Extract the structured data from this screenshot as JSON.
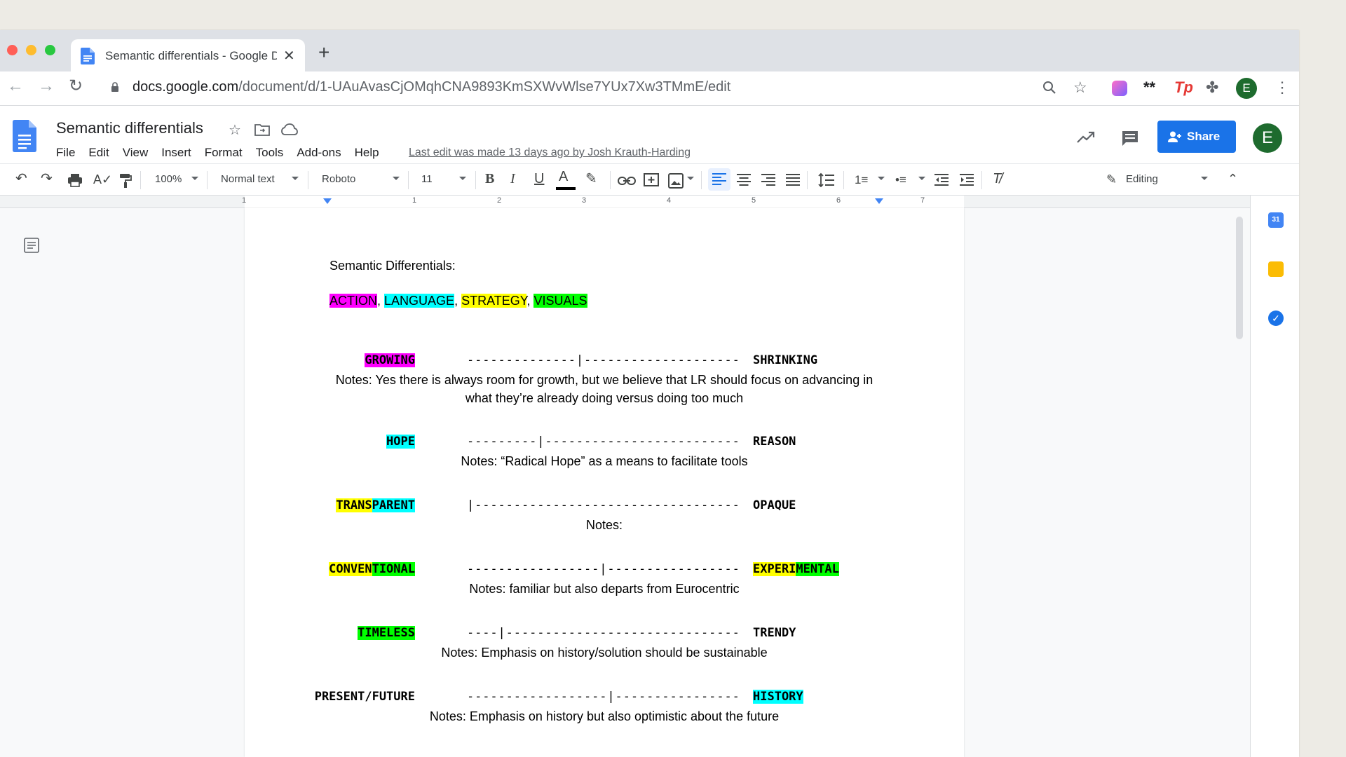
{
  "browser": {
    "tab_title": "Semantic differentials - Google Docs",
    "tab_close": "✕",
    "new_tab": "+",
    "url_host": "docs.google.com",
    "url_path": "/document/d/1-UAuAvasCjOMqhCNA9893KmSXWvWlse7YUx7Xw3TMmE/edit",
    "profile_initial": "E"
  },
  "docs": {
    "title": "Semantic differentials",
    "menu": [
      "File",
      "Edit",
      "View",
      "Insert",
      "Format",
      "Tools",
      "Add-ons",
      "Help"
    ],
    "last_edit": "Last edit was made 13 days ago by Josh Krauth-Harding",
    "share_label": "Share",
    "avatar_initial": "E"
  },
  "toolbar": {
    "zoom": "100%",
    "style": "Normal text",
    "font": "Roboto",
    "font_size": "11",
    "mode": "Editing"
  },
  "ruler": {
    "marks": [
      "1",
      "1",
      "2",
      "3",
      "4",
      "5",
      "6",
      "7"
    ]
  },
  "colors": {
    "accent": "#1a73e8",
    "magenta": "#ff00ff",
    "cyan": "#00ffff",
    "yellow": "#ffff00",
    "green": "#00ff00"
  },
  "document": {
    "heading": "Semantic Differentials:",
    "legend": {
      "action": "ACTION",
      "language": "LANGUAGE",
      "strategy": "STRATEGY",
      "visuals": "VISUALS",
      "sep": ", "
    },
    "rows": [
      {
        "left_parts": [
          "GROWING"
        ],
        "scale": "--------------|--------------------",
        "right_parts": [
          "SHRINKING"
        ],
        "note": "Notes: Yes there is always room for growth, but we believe that LR should focus on advancing in what they’re already doing versus doing too much"
      },
      {
        "left_parts": [
          "HOPE"
        ],
        "scale": "---------|-------------------------",
        "right_parts": [
          "REASON"
        ],
        "note": "Notes: “Radical Hope” as a means to facilitate tools"
      },
      {
        "left_parts": [
          "TRANS",
          "PARENT"
        ],
        "scale": "|----------------------------------",
        "right_parts": [
          "OPAQUE"
        ],
        "note": "Notes:"
      },
      {
        "left_parts": [
          "CONVEN",
          "TIONAL"
        ],
        "scale": "-----------------|-----------------",
        "right_parts": [
          "EXPERI",
          "MENTAL"
        ],
        "note": "Notes: familiar but also departs from Eurocentric"
      },
      {
        "left_parts": [
          "TIMELESS"
        ],
        "scale": "----|------------------------------",
        "right_parts": [
          "TRENDY"
        ],
        "note": "Notes: Emphasis on history/solution should be sustainable"
      },
      {
        "left_parts": [
          "PRESENT/FUTURE"
        ],
        "scale": "------------------|----------------",
        "right_parts": [
          "HISTORY"
        ],
        "note": "Notes: Emphasis on history but also optimistic about the future"
      }
    ]
  }
}
